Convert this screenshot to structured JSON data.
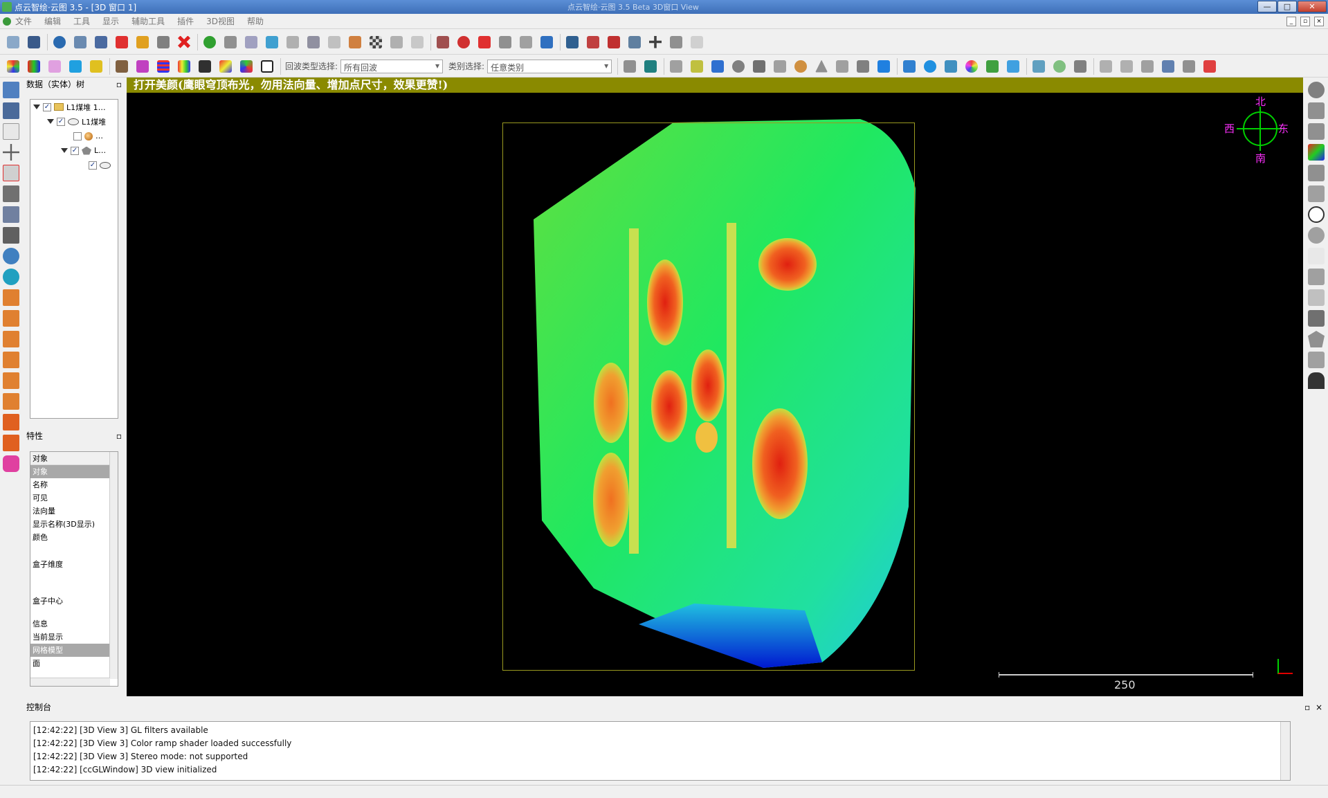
{
  "window": {
    "title": "点云智绘·云图 3.5 - [3D 窗口 1]",
    "center_caption": "点云智绘·云图 3.5 Beta   3D窗口   View",
    "controls": [
      "—",
      "□",
      "✕"
    ]
  },
  "menu": {
    "items": [
      "文件",
      "编辑",
      "工具",
      "显示",
      "辅助工具",
      "插件",
      "3D视图",
      "帮助"
    ]
  },
  "toolbar2": {
    "echo_label": "回波类型选择:",
    "echo_value": "所有回波",
    "class_label": "类别选择:",
    "class_value": "任意类别"
  },
  "db_tree": {
    "title": "数据（实体）树",
    "items": [
      {
        "label": "L1煤堆 1…",
        "depth": 0,
        "checked": true
      },
      {
        "label": "L1煤堆",
        "depth": 1,
        "checked": true
      },
      {
        "label": "…",
        "depth": 2,
        "checked": false
      },
      {
        "label": "L…",
        "depth": 2,
        "checked": true
      },
      {
        "label": "",
        "depth": 3,
        "checked": true
      }
    ]
  },
  "properties": {
    "title": "特性",
    "header": "对象",
    "rows": [
      "对象",
      "名称",
      "可见",
      "法向量",
      "显示名称(3D显示)",
      "颜色",
      "盒子维度",
      "盒子中心",
      "信息",
      "当前显示",
      "网格模型",
      "面"
    ]
  },
  "view": {
    "banner": "打开美颜(鹰眼穹顶布光，勿用法向量、增加点尺寸，效果更赞!)",
    "compass": {
      "north": "北",
      "south": "南",
      "east": "东",
      "west": "西"
    },
    "scale_value": "250"
  },
  "console": {
    "title": "控制台",
    "lines": [
      "[12:42:22] [3D View 3] GL filters available",
      "[12:42:22] [3D View 3] Color ramp shader loaded successfully",
      "[12:42:22] [3D View 3] Stereo mode: not supported",
      "[12:42:22] [ccGLWindow] 3D view initialized"
    ]
  },
  "colors": {
    "banner": "#8a8a00",
    "compass": "#00d000",
    "compass_labels": "#ff30ff",
    "cloud_low": "#0020d0",
    "cloud_mid": "#20e860",
    "cloud_high": "#e02010"
  }
}
